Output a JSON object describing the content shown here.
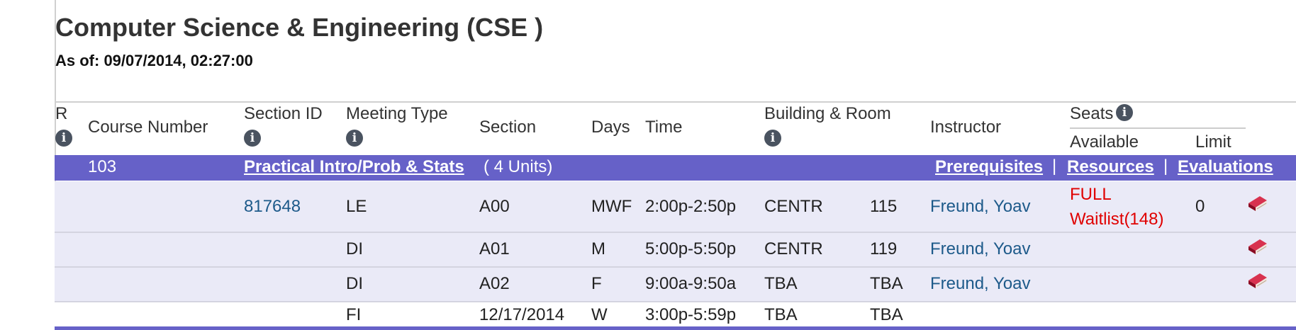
{
  "page": {
    "title": "Computer Science & Engineering (CSE )",
    "as_of": "As of: 09/07/2014, 02:27:00"
  },
  "headers": {
    "r": "R",
    "course_number": "Course Number",
    "section_id": "Section ID",
    "meeting_type": "Meeting Type",
    "section": "Section",
    "days": "Days",
    "time": "Time",
    "building_room": "Building & Room",
    "instructor": "Instructor",
    "seats": "Seats",
    "available": "Available",
    "limit": "Limit"
  },
  "course": {
    "number": "103",
    "title": "Practical Intro/Prob & Stats ",
    "units": "( 4 Units)",
    "prerequisites": "Prerequisites",
    "resources": "Resources",
    "evaluations": "Evaluations",
    "separator": "|"
  },
  "rows": [
    {
      "section_id": "817648",
      "meeting_type": "LE",
      "section": "A00",
      "days": "MWF",
      "time": "2:00p-2:50p",
      "building": "CENTR",
      "room": "115",
      "instructor": "Freund, Yoav",
      "available_status": "FULL",
      "waitlist": "Waitlist(148)",
      "limit": "0",
      "icon": "book-icon"
    },
    {
      "meeting_type": "DI",
      "section": "A01",
      "days": "M",
      "time": "5:00p-5:50p",
      "building": "CENTR",
      "room": "119",
      "instructor": "Freund, Yoav",
      "icon": "book-icon"
    },
    {
      "meeting_type": "DI",
      "section": "A02",
      "days": "F",
      "time": "9:00a-9:50a",
      "building": "TBA",
      "room": "TBA",
      "instructor": "Freund, Yoav",
      "icon": "book-icon"
    },
    {
      "meeting_type": "FI",
      "section": "12/17/2014",
      "days": "W",
      "time": "3:00p-5:59p",
      "building": "TBA",
      "room": "TBA"
    }
  ],
  "colors": {
    "course_bar": "#6661c8",
    "row_bg": "#eaeaf7",
    "link": "#1d5a8a",
    "full_status": "#e00000",
    "info_icon": "#4a5360",
    "book_icon": "#b3112e"
  }
}
